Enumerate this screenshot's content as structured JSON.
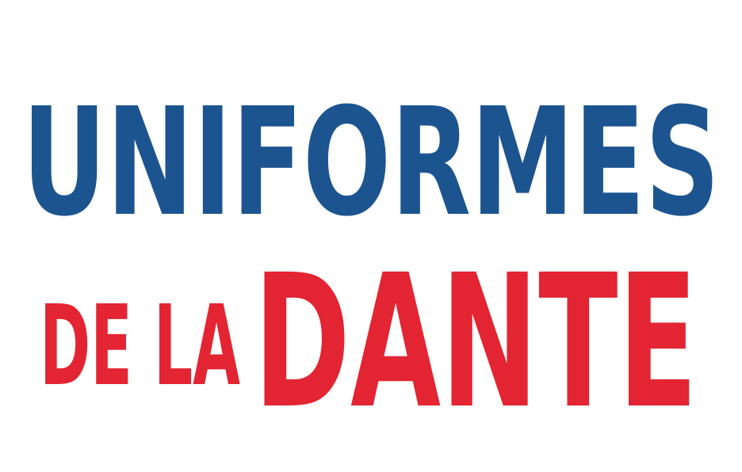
{
  "logo": {
    "line1": "UNIFORMES",
    "line2_prefix": "DE LA",
    "line2_main": "DANTE",
    "colors": {
      "blue": "#1c5490",
      "red": "#e32432",
      "background": "#ffffff"
    }
  }
}
